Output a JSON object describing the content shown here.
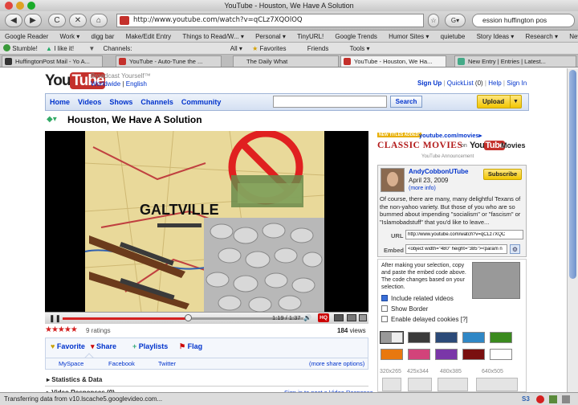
{
  "window": {
    "title": "YouTube - Houston, We Have A Solution"
  },
  "nav": {
    "back": "◀",
    "forward": "▶",
    "reload": "C",
    "stop": "✕",
    "home": "⌂",
    "url": "http://www.youtube.com/watch?v=qCLz7XQOlOQ",
    "search_value": "ession huffington pos"
  },
  "bookmarks": [
    "Google Reader",
    "Work ▾",
    "digg bar",
    "Make/Edit Entry",
    "Things to Read/W... ▾",
    "Personal ▾",
    "TinyURL!",
    "Google Trends",
    "Humor Sites ▾",
    "quietube",
    "Story Ideas ▾",
    "Research ▾",
    "New York Times"
  ],
  "toolbar2": {
    "stumble": "Stumble!",
    "like": "I like it!",
    "channels": "Channels:",
    "all": "All ▾",
    "favorites": "Favorites",
    "friends": "Friends",
    "tools": "Tools ▾"
  },
  "tabs": [
    {
      "label": "HuffingtonPost Mail - Yo A...",
      "active": false
    },
    {
      "label": "YouTube - Auto-Tune the ...",
      "active": false
    },
    {
      "label": "The Daily What",
      "active": false
    },
    {
      "label": "YouTube - Houston, We Ha...",
      "active": true
    },
    {
      "label": "New Entry | Entries | Latest...",
      "active": false
    }
  ],
  "yt": {
    "logo_you": "You",
    "logo_tube": "Tube",
    "tagline": "Broadcast Yourself™",
    "worldwide": "Worldwide",
    "english": "English",
    "signup": "Sign Up",
    "quicklist": "QuickList",
    "quicklist_count": "(0)",
    "help": "Help",
    "signin": "Sign In",
    "menu": [
      "Home",
      "Videos",
      "Shows",
      "Channels",
      "Community"
    ],
    "search_button": "Search",
    "upload_button": "Upload"
  },
  "video": {
    "title": "Houston, We Have A Solution",
    "map_label": "GALTVILLE",
    "time": "1:19 / 1:37",
    "hq": "HQ",
    "progress": 0.52,
    "ratings": "9 ratings",
    "stars": 5,
    "views_count": "184",
    "views_label": "views"
  },
  "actions": {
    "favorite": "Favorite",
    "share": "Share",
    "playlists": "Playlists",
    "flag": "Flag",
    "myspace": "MySpace",
    "facebook": "Facebook",
    "twitter": "Twitter",
    "more_share": "(more share options)"
  },
  "sections": {
    "stats": "Statistics & Data",
    "responses": "Video Responses",
    "responses_count": "(0)",
    "signin_post": "Sign in to post a Video Response"
  },
  "ad": {
    "site": "youtube.com/movies▸",
    "badge": "NEW TITLES ADDED!",
    "classic": "CLASSIC MOVIES",
    "on": "on",
    "you": "You",
    "tube": "Tube",
    "movies": "Movies",
    "announcement": "YouTube Announcement"
  },
  "channel": {
    "name": "AndyCobbonUTube",
    "date": "April 23, 2009",
    "more_info": "(more info)",
    "subscribe": "Subscribe",
    "description": "Of course, there are many, many delightful Texans of the non-yahoo variety. But those of you who are so bummed about impending \"socialism\" or \"fascism\" or \"Islamobadstuff\" that you'd like to leave...",
    "url_label": "URL",
    "url_value": "http://www.youtube.com/watch?v=qCLz7XQC",
    "embed_label": "Embed",
    "embed_value": "<object width=\"480\" height=\"385\"><param n"
  },
  "embed": {
    "instructions": "After making your selection, copy and paste the embed code above. The code changes based on your selection.",
    "include_related": "Include related videos",
    "show_border": "Show Border",
    "delayed_cookies": "Enable delayed cookies [?]",
    "sizes": [
      "320x265",
      "425x344",
      "480x385",
      "640x505"
    ],
    "colors": [
      "#999999",
      "#3a3a3a",
      "#2b4a78",
      "#2f87c6",
      "#3a8a1e",
      "#e8780f",
      "#d2437a",
      "#7a36a8",
      "#7a0f0f",
      "#ffffff"
    ]
  },
  "status": {
    "text": "Transferring data from v10.lscache5.googlevideo.com...",
    "s3": "S3"
  }
}
